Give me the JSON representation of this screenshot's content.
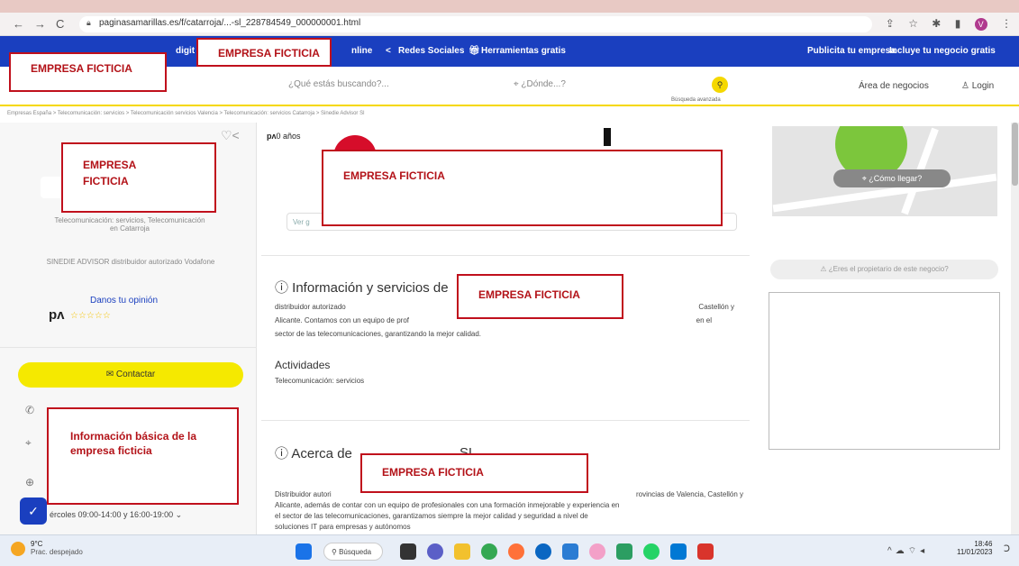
{
  "browser": {
    "url": "paginasamarillas.es/f/catarroja/...-sl_228784549_000000001.html",
    "nav_back": "←",
    "nav_forward": "→",
    "nav_reload": "C",
    "profile": "V"
  },
  "topbar": {
    "item_digital": "digit",
    "item_online": "nline",
    "social": "Redes Sociales",
    "tools": "Herramientas gratis",
    "publish": "Publicita tu empresa",
    "include": "Incluye tu negocio gratis"
  },
  "search": {
    "what_placeholder": "¿Qué estás buscando?...",
    "where_placeholder": "¿Dónde...?",
    "advanced": "Búsqueda avanzada",
    "business_area": "Área de negocios",
    "login": "Login"
  },
  "breadcrumb": "Empresas España  >  Telecomunicación: servicios  >  Telecomunicación servicios Valencia  >  Telecomunicación: servicios Catarroja  >  Sinedie Advisor Sl",
  "left": {
    "category": "Telecomunicación: servicios, Telecomunicación",
    "category2": "en Catarroja",
    "tagline": "SINEDIE ADVISOR distribuidor autorizado Vodafone",
    "opinion": "Danos tu opinión",
    "logo_small": "pᴧ",
    "stars": "☆☆☆☆☆",
    "contact": "Contactar",
    "hours": "ércoles 09:00-14:00 y 16:00-19:00"
  },
  "middle": {
    "logo_top": "pᴧ",
    "years": "0 años",
    "see_more": "Ver g",
    "info_title": "Información y servicios de",
    "info_line1": "distribuidor autorizado",
    "info_line1b": "Castellón y",
    "info_line2": "Alicante. Contamos con un equipo de prof",
    "info_line2b": "en el",
    "info_line3": "sector de las telecomunicaciones, garantizando la mejor calidad.",
    "activities_title": "Actividades",
    "activities_value": "Telecomunicación: servicios",
    "about_title": "Acerca de",
    "about_title_end": "SL",
    "about_line1": "Distribuidor autori",
    "about_line1b": "rovincias de Valencia, Castellón y",
    "about_line2": "Alicante, además de contar con un equipo de profesionales con una formación inmejorable y experiencia en",
    "about_line3": "el sector de las telecomunicaciones, garantizamos siempre la mejor calidad y seguridad a nivel de",
    "about_line4": "soluciones IT para empresas y autónomos"
  },
  "right": {
    "how_to_get": "¿Cómo llegar?",
    "owner": "¿Eres el propietario de este negocio?"
  },
  "overlays": {
    "box1": "EMPRESA FICTICIA",
    "box2": "EMPRESA FICTICIA",
    "box3": "EMPRESA\nFICTICIA",
    "box4": "EMPRESA FICTICIA",
    "box5": "EMPRESA FICTICIA",
    "box6": "Información básica de la empresa ficticia",
    "box7": "EMPRESA FICTICIA"
  },
  "taskbar": {
    "temp": "9°C",
    "weather": "Prac. despejado",
    "search": "Búsqueda",
    "time": "18:46",
    "date": "11/01/2023"
  }
}
